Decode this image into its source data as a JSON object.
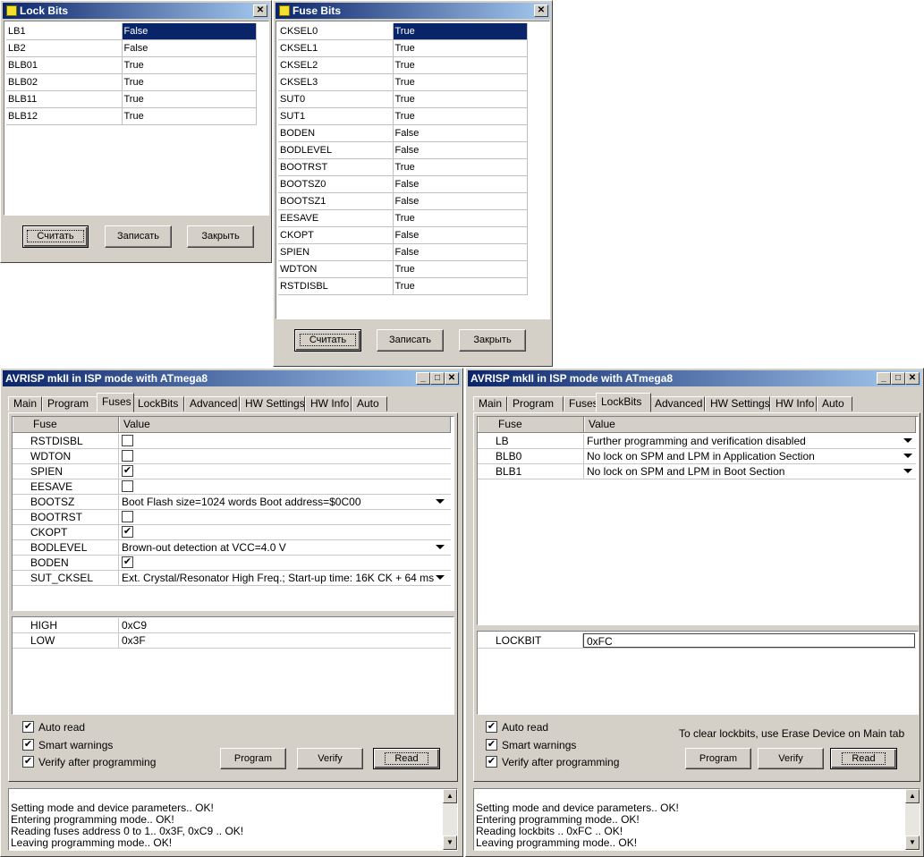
{
  "lockbits_dialog": {
    "title": "Lock Bits",
    "rows": [
      {
        "name": "LB1",
        "value": "False"
      },
      {
        "name": "LB2",
        "value": "False"
      },
      {
        "name": "BLB01",
        "value": "True"
      },
      {
        "name": "BLB02",
        "value": "True"
      },
      {
        "name": "BLB11",
        "value": "True"
      },
      {
        "name": "BLB12",
        "value": "True"
      }
    ],
    "buttons": {
      "read": "Считать",
      "write": "Записать",
      "close": "Закрыть"
    }
  },
  "fusebits_dialog": {
    "title": "Fuse Bits",
    "rows": [
      {
        "name": "CKSEL0",
        "value": "True"
      },
      {
        "name": "CKSEL1",
        "value": "True"
      },
      {
        "name": "CKSEL2",
        "value": "True"
      },
      {
        "name": "CKSEL3",
        "value": "True"
      },
      {
        "name": "SUT0",
        "value": "True"
      },
      {
        "name": "SUT1",
        "value": "True"
      },
      {
        "name": "BODEN",
        "value": "False"
      },
      {
        "name": "BODLEVEL",
        "value": "False"
      },
      {
        "name": "BOOTRST",
        "value": "True"
      },
      {
        "name": "BOOTSZ0",
        "value": "False"
      },
      {
        "name": "BOOTSZ1",
        "value": "False"
      },
      {
        "name": "EESAVE",
        "value": "True"
      },
      {
        "name": "CKOPT",
        "value": "False"
      },
      {
        "name": "SPIEN",
        "value": "False"
      },
      {
        "name": "WDTON",
        "value": "True"
      },
      {
        "name": "RSTDISBL",
        "value": "True"
      }
    ],
    "buttons": {
      "read": "Считать",
      "write": "Записать",
      "close": "Закрыть"
    }
  },
  "avr_left": {
    "title": "AVRISP mkII in ISP mode with ATmega8",
    "tabs": [
      "Main",
      "Program",
      "Fuses",
      "LockBits",
      "Advanced",
      "HW Settings",
      "HW Info",
      "Auto"
    ],
    "active_tab": "Fuses",
    "col_fuse": "Fuse",
    "col_value": "Value",
    "fuses": [
      {
        "name": "RSTDISBL",
        "kind": "check",
        "checked": false
      },
      {
        "name": "WDTON",
        "kind": "check",
        "checked": false
      },
      {
        "name": "SPIEN",
        "kind": "check",
        "checked": true
      },
      {
        "name": "EESAVE",
        "kind": "check",
        "checked": false
      },
      {
        "name": "BOOTSZ",
        "kind": "select",
        "value": "Boot Flash size=1024 words Boot address=$0C00"
      },
      {
        "name": "BOOTRST",
        "kind": "check",
        "checked": false
      },
      {
        "name": "CKOPT",
        "kind": "check",
        "checked": true
      },
      {
        "name": "BODLEVEL",
        "kind": "select",
        "value": "Brown-out detection at VCC=4.0 V"
      },
      {
        "name": "BODEN",
        "kind": "check",
        "checked": true
      },
      {
        "name": "SUT_CKSEL",
        "kind": "select",
        "value": "Ext. Crystal/Resonator High Freq.; Start-up time: 16K CK + 64 ms"
      }
    ],
    "bytes": [
      {
        "name": "HIGH",
        "value": "0xC9"
      },
      {
        "name": "LOW",
        "value": "0x3F"
      }
    ],
    "options": {
      "auto_read": "Auto read",
      "smart_warnings": "Smart warnings",
      "verify_after": "Verify after programming"
    },
    "buttons": {
      "program": "Program",
      "verify": "Verify",
      "read": "Read"
    },
    "log": [
      "Setting mode and device parameters.. OK!",
      "Entering programming mode.. OK!",
      "Reading fuses address 0 to 1.. 0x3F, 0xC9 .. OK!",
      "Leaving programming mode.. OK!"
    ]
  },
  "avr_right": {
    "title": "AVRISP mkII in ISP mode with ATmega8",
    "tabs": [
      "Main",
      "Program",
      "Fuses",
      "LockBits",
      "Advanced",
      "HW Settings",
      "HW Info",
      "Auto"
    ],
    "active_tab": "LockBits",
    "col_fuse": "Fuse",
    "col_value": "Value",
    "locks": [
      {
        "name": "LB",
        "value": "Further programming and verification disabled"
      },
      {
        "name": "BLB0",
        "value": "No lock on SPM and LPM in Application Section"
      },
      {
        "name": "BLB1",
        "value": "No lock on SPM and LPM in Boot Section"
      }
    ],
    "lockbit_label": "LOCKBIT",
    "lockbit_value": "0xFC",
    "hint": "To clear lockbits, use Erase Device on Main tab",
    "options": {
      "auto_read": "Auto read",
      "smart_warnings": "Smart warnings",
      "verify_after": "Verify after programming"
    },
    "buttons": {
      "program": "Program",
      "verify": "Verify",
      "read": "Read"
    },
    "log": [
      "Setting mode and device parameters.. OK!",
      "Entering programming mode.. OK!",
      "Reading lockbits .. 0xFC .. OK!",
      "Leaving programming mode.. OK!"
    ]
  }
}
